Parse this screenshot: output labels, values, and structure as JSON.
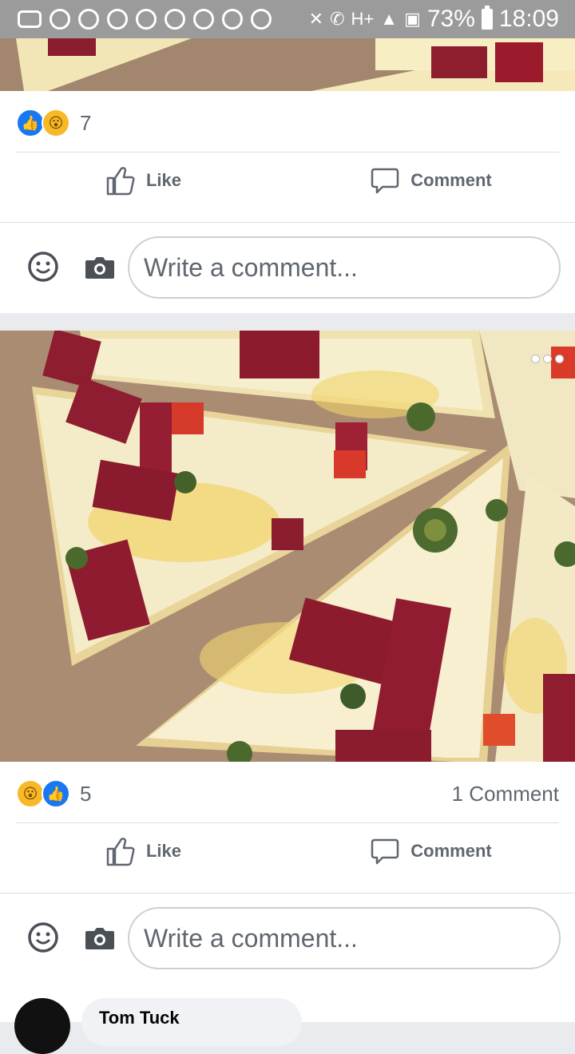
{
  "status_bar": {
    "battery": "73%",
    "time": "18:09",
    "signal_label": "H+"
  },
  "post1": {
    "reaction_count": "7",
    "like_label": "Like",
    "comment_label": "Comment",
    "comment_placeholder": "Write a comment..."
  },
  "post2": {
    "reaction_count": "5",
    "comments_count": "1 Comment",
    "like_label": "Like",
    "comment_label": "Comment",
    "comment_placeholder": "Write a comment..."
  },
  "comment_preview": {
    "author": "Tom Tuck"
  },
  "colors": {
    "like_blue": "#1877f2",
    "wow_yellow": "#f7b928",
    "text_gray": "#606770",
    "divider": "#dadde1"
  }
}
